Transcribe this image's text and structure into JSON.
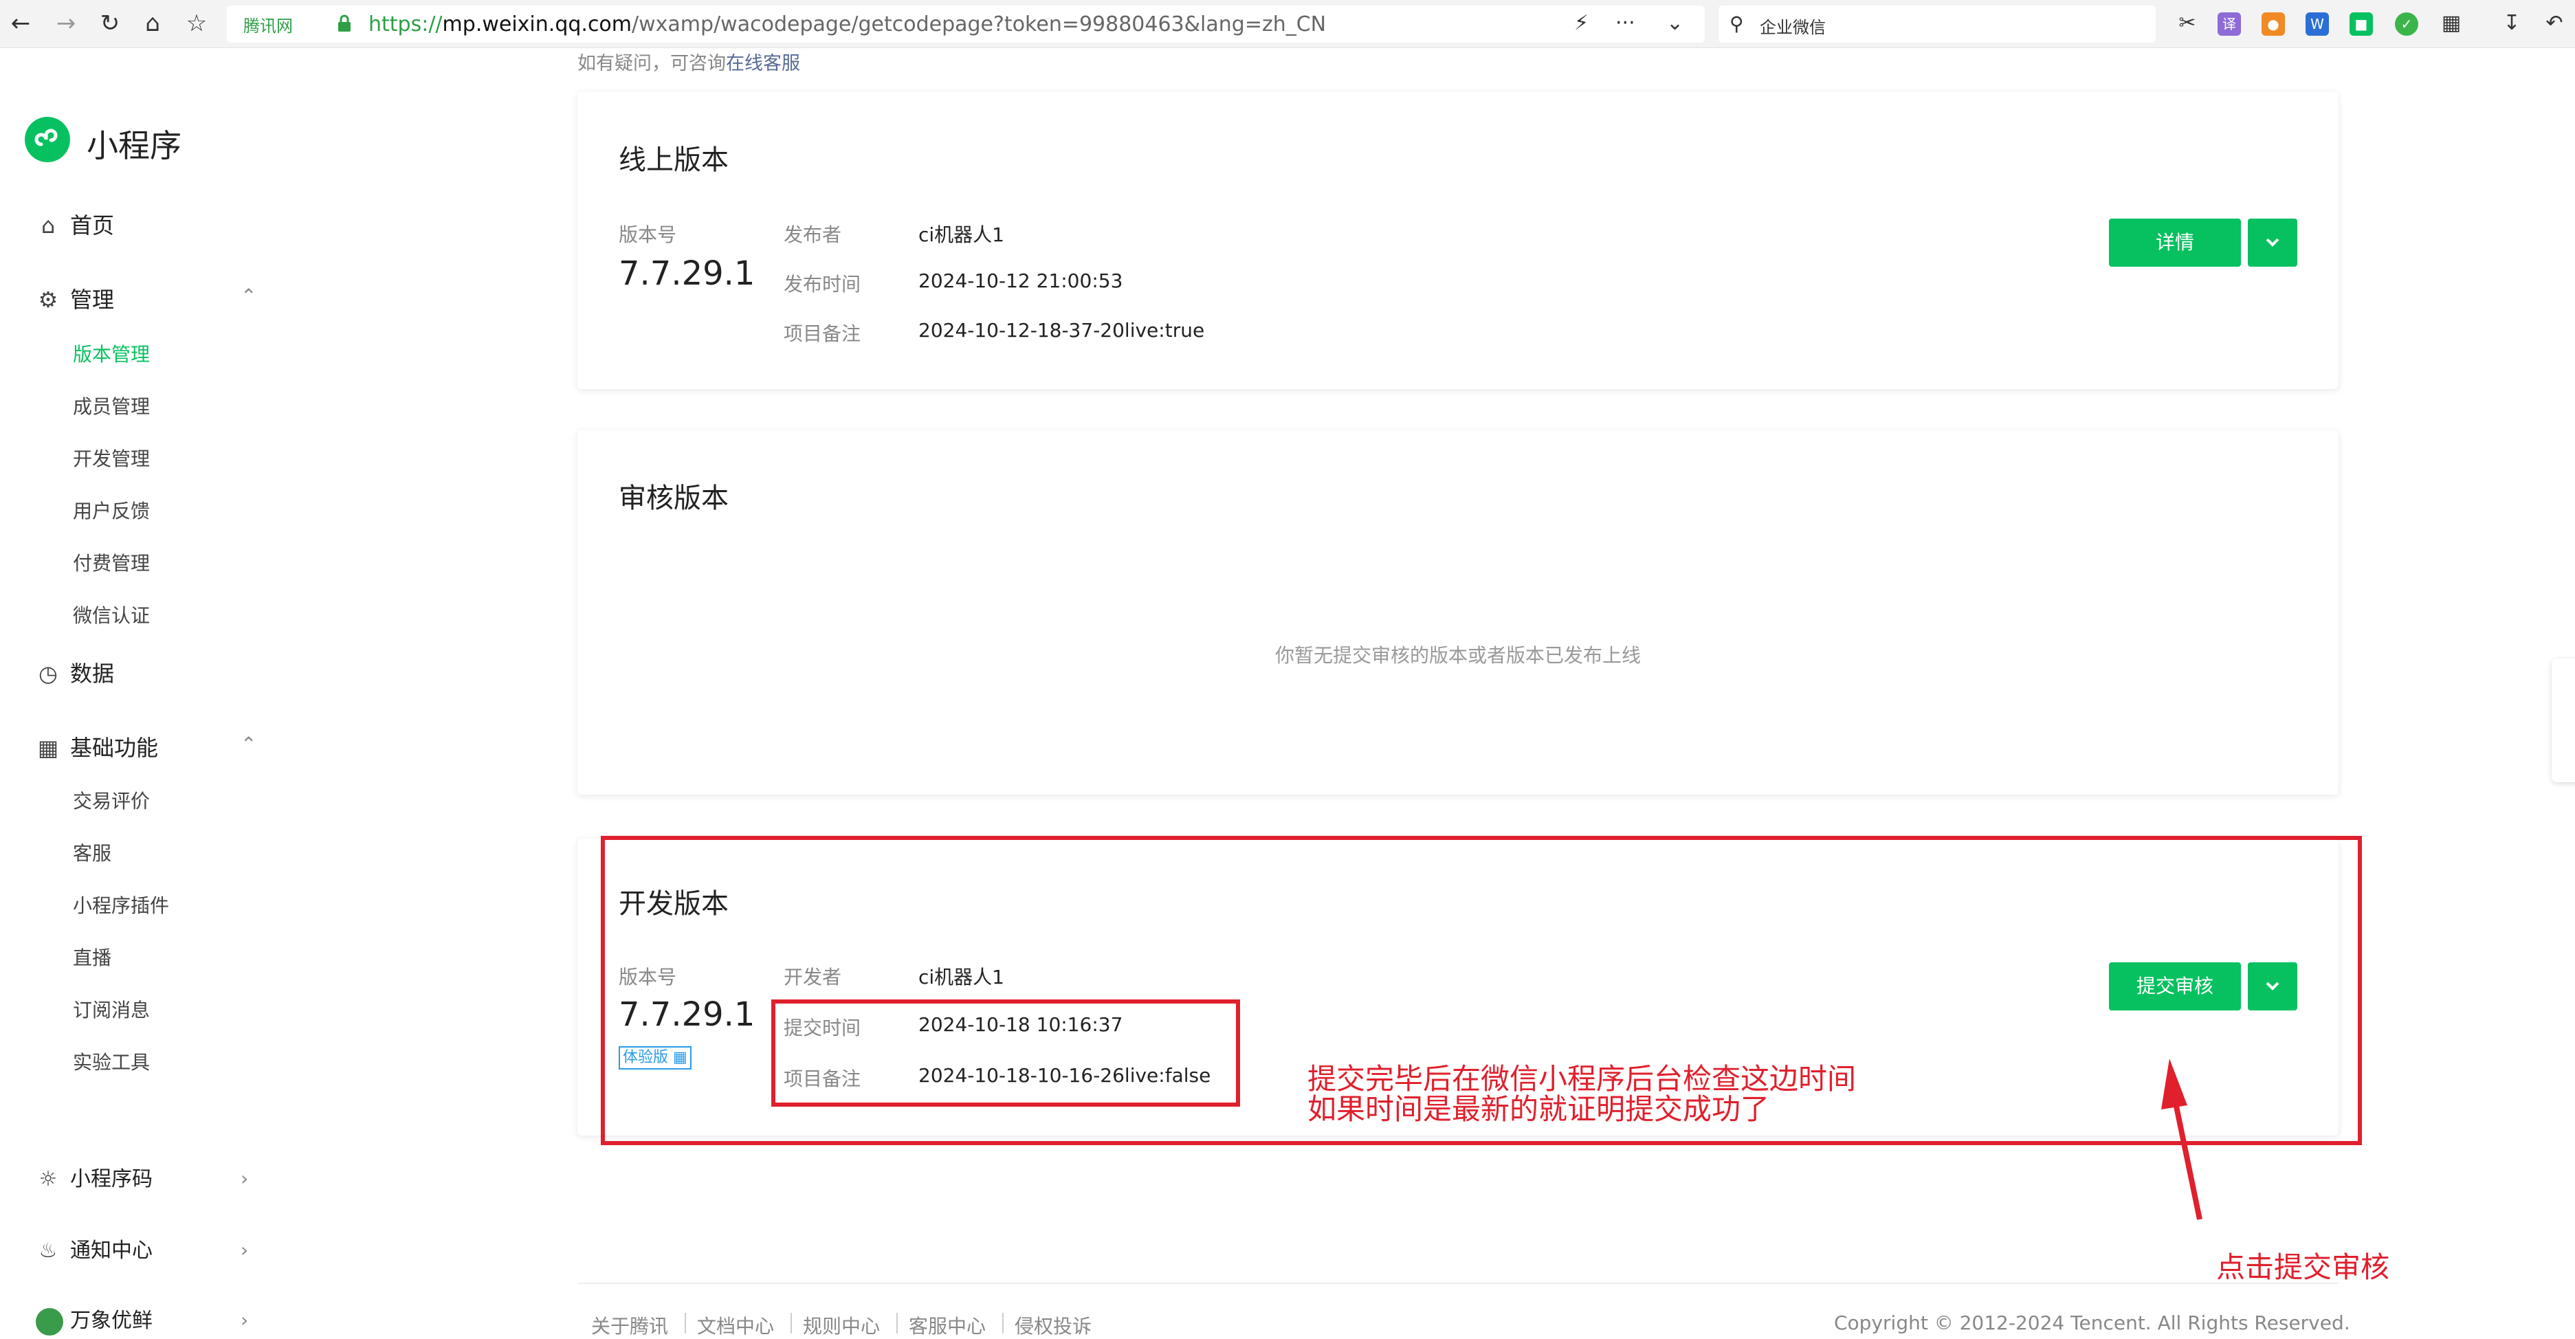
{
  "browser": {
    "site_label": "腾讯网",
    "url_scheme": "https://",
    "url_host": "mp.weixin.qq.com",
    "url_path": "/wxamp/wacodepage/getcodepage?token=99880463&lang=zh_CN",
    "search_text": "企业微信",
    "icons": [
      "back-icon",
      "forward-icon",
      "reload-icon",
      "home-icon",
      "star-icon",
      "lock-icon",
      "bolt-icon",
      "more-icon",
      "chevron-down-icon",
      "search-icon",
      "scissors-icon",
      "extension-icons",
      "puzzle-icon",
      "download-icon",
      "undo-icon"
    ]
  },
  "sidebar": {
    "app_title": "小程序",
    "home": "首页",
    "manage": "管理",
    "manage_items": [
      "版本管理",
      "成员管理",
      "开发管理",
      "用户反馈",
      "付费管理",
      "微信认证"
    ],
    "data": "数据",
    "basic": "基础功能",
    "basic_items": [
      "交易评价",
      "客服",
      "小程序插件",
      "直播",
      "订阅消息",
      "实验工具"
    ],
    "qrcode": "小程序码",
    "notify": "通知中心",
    "account": "万象优鲜"
  },
  "main": {
    "hint_prefix": "如有疑问，可咨询",
    "hint_link": "在线客服",
    "online": {
      "title": "线上版本",
      "version_label": "版本号",
      "version": "7.7.29.1",
      "publisher_label": "发布者",
      "publisher": "ci机器人1",
      "publish_time_label": "发布时间",
      "publish_time": "2024-10-12 21:00:53",
      "note_label": "项目备注",
      "note": "2024-10-12-18-37-20live:true",
      "detail_button": "详情"
    },
    "review": {
      "title": "审核版本",
      "empty": "你暂无提交审核的版本或者版本已发布上线"
    },
    "dev": {
      "title": "开发版本",
      "version_label": "版本号",
      "version": "7.7.29.1",
      "tag": "体验版",
      "developer_label": "开发者",
      "developer": "ci机器人1",
      "submit_time_label": "提交时间",
      "submit_time": "2024-10-18 10:16:37",
      "note_label": "项目备注",
      "note": "2024-10-18-10-16-26live:false",
      "submit_button": "提交审核"
    }
  },
  "annotations": {
    "line1": "提交完毕后在微信小程序后台检查这边时间",
    "line2": "如果时间是最新的就证明提交成功了",
    "click_hint": "点击提交审核",
    "color": "#e0202d"
  },
  "footer": {
    "links": [
      "关于腾讯",
      "文档中心",
      "规则中心",
      "客服中心",
      "侵权投诉"
    ],
    "copyright": "Copyright © 2012-2024 Tencent. All Rights Reserved."
  },
  "colors": {
    "brand": "#07c160",
    "link": "#576b95"
  }
}
